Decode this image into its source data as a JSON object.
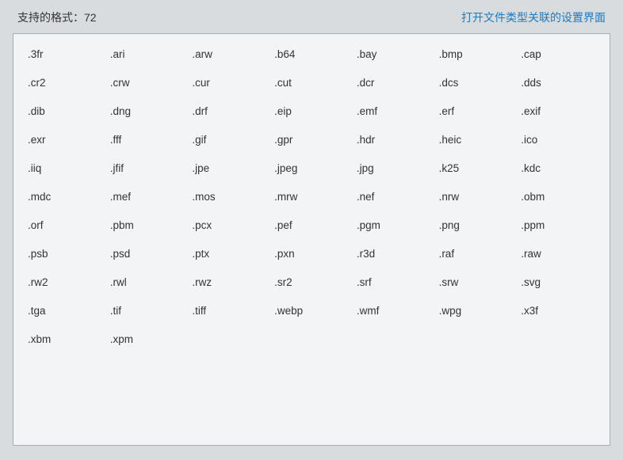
{
  "header": {
    "label_prefix": "支持的格式：",
    "count": "72",
    "link": "打开文件类型关联的设置界面"
  },
  "formats": [
    ".3fr",
    ".ari",
    ".arw",
    ".b64",
    ".bay",
    ".bmp",
    ".cap",
    ".cr2",
    ".crw",
    ".cur",
    ".cut",
    ".dcr",
    ".dcs",
    ".dds",
    ".dib",
    ".dng",
    ".drf",
    ".eip",
    ".emf",
    ".erf",
    ".exif",
    ".exr",
    ".fff",
    ".gif",
    ".gpr",
    ".hdr",
    ".heic",
    ".ico",
    ".iiq",
    ".jfif",
    ".jpe",
    ".jpeg",
    ".jpg",
    ".k25",
    ".kdc",
    ".mdc",
    ".mef",
    ".mos",
    ".mrw",
    ".nef",
    ".nrw",
    ".obm",
    ".orf",
    ".pbm",
    ".pcx",
    ".pef",
    ".pgm",
    ".png",
    ".ppm",
    ".psb",
    ".psd",
    ".ptx",
    ".pxn",
    ".r3d",
    ".raf",
    ".raw",
    ".rw2",
    ".rwl",
    ".rwz",
    ".sr2",
    ".srf",
    ".srw",
    ".svg",
    ".tga",
    ".tif",
    ".tiff",
    ".webp",
    ".wmf",
    ".wpg",
    ".x3f",
    ".xbm",
    ".xpm"
  ]
}
